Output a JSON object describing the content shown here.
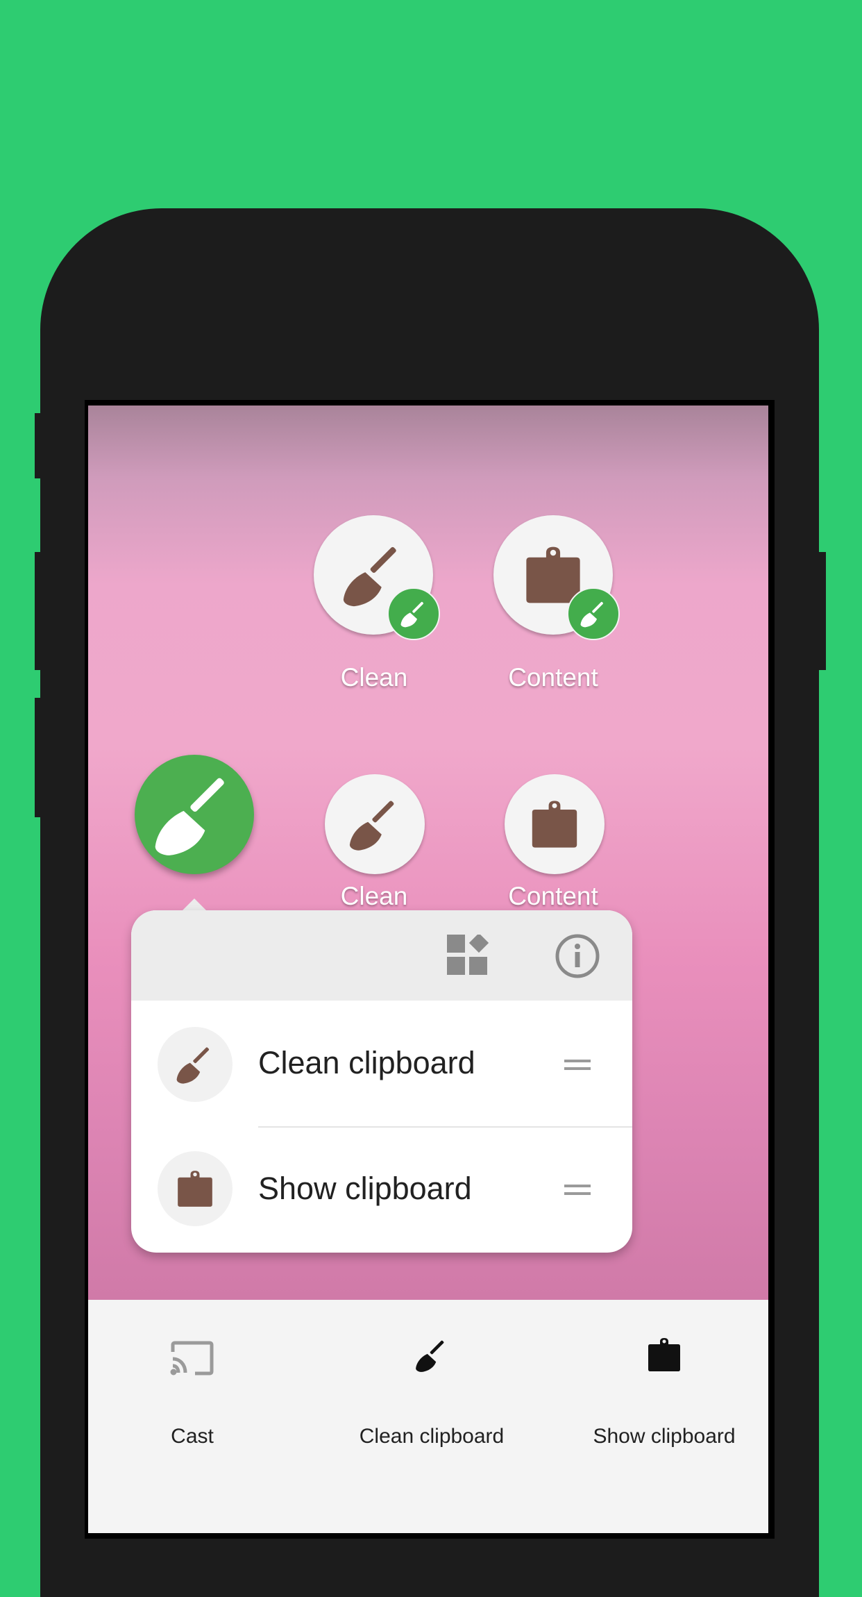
{
  "home": {
    "shortcuts": [
      {
        "label": "Clean"
      },
      {
        "label": "Content"
      }
    ],
    "apps": [
      {
        "label": "Clean"
      },
      {
        "label": "Content"
      }
    ]
  },
  "popup": {
    "items": [
      {
        "label": "Clean clipboard"
      },
      {
        "label": "Show clipboard"
      }
    ]
  },
  "quick_settings": {
    "tiles": [
      {
        "label": "Cast"
      },
      {
        "label": "Clean clipboard"
      },
      {
        "label": "Show clipboard"
      }
    ]
  },
  "colors": {
    "background": "#2ecc71",
    "accent_green": "#4caf50",
    "icon_brown": "#795548"
  }
}
